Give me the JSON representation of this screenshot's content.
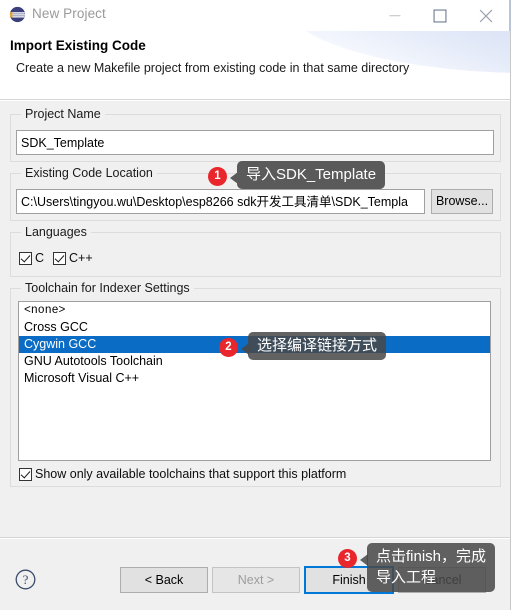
{
  "window": {
    "title": "New Project",
    "icon": "eclipse-icon",
    "controls": {
      "minimize": "minimize-icon",
      "maximize": "maximize-icon",
      "close": "close-icon"
    }
  },
  "header": {
    "title": "Import Existing Code",
    "description": "Create a new Makefile project from existing code in that same directory"
  },
  "project_name": {
    "group_label": "Project Name",
    "value": "SDK_Template",
    "placeholder": ""
  },
  "existing_code_location": {
    "group_label": "Existing Code Location",
    "value": "C:\\Users\\tingyou.wu\\Desktop\\esp8266 sdk开发工具清单\\SDK_Templa",
    "placeholder": "",
    "browse_label": "Browse..."
  },
  "languages": {
    "group_label": "Languages",
    "options": [
      {
        "label": "C",
        "checked": true
      },
      {
        "label": "C++",
        "checked": true
      }
    ]
  },
  "toolchain": {
    "group_label": "Toolchain for Indexer Settings",
    "items": [
      {
        "label": "<none>",
        "selected": false
      },
      {
        "label": "Cross GCC",
        "selected": false
      },
      {
        "label": "Cygwin GCC",
        "selected": true
      },
      {
        "label": "GNU Autotools Toolchain",
        "selected": false
      },
      {
        "label": "Microsoft Visual C++",
        "selected": false
      }
    ],
    "show_only_available": {
      "label": "Show only available toolchains that support this platform",
      "checked": true
    }
  },
  "footer": {
    "help_icon": "help-icon",
    "buttons": [
      {
        "name": "back-button",
        "label": "< Back",
        "disabled": false,
        "focused": false
      },
      {
        "name": "next-button",
        "label": "Next >",
        "disabled": true,
        "focused": false
      },
      {
        "name": "finish-button",
        "label": "Finish",
        "disabled": false,
        "focused": true
      },
      {
        "name": "cancel-button",
        "label": "Cancel",
        "disabled": false,
        "focused": false
      }
    ]
  },
  "callouts": [
    {
      "number": "1",
      "text": "导入SDK_Template"
    },
    {
      "number": "2",
      "text": "选择编译链接方式"
    },
    {
      "number": "3",
      "text": "点击finish，完成\n导入工程"
    }
  ],
  "colors": {
    "selection_blue": "#0a6cc4",
    "badge_red": "#e8262b",
    "callout_gray": "#5a5a5a",
    "focus_blue": "#0078d7"
  }
}
